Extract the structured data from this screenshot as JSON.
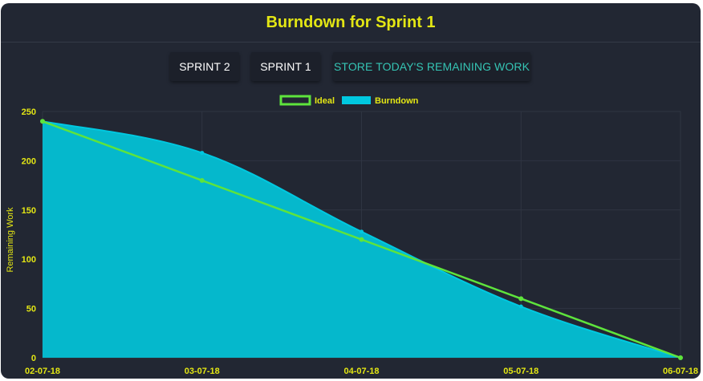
{
  "header": {
    "title": "Burndown for Sprint 1"
  },
  "toolbar": {
    "sprint2_label": "SPRINT 2",
    "sprint1_label": "SPRINT 1",
    "store_label": "STORE TODAY'S REMAINING WORK"
  },
  "colors": {
    "card_bg": "#222733",
    "title": "#e3e614",
    "ideal_line": "#5ee43c",
    "burndown_fill": "#05b8cc",
    "burndown_fill_light": "#00c8e0",
    "accent_button_text": "#35c4b4",
    "grid": "#2f3542"
  },
  "chart_data": {
    "type": "line",
    "title": "",
    "xlabel": "",
    "ylabel": "Remaining Work",
    "categories": [
      "02-07-18",
      "03-07-18",
      "04-07-18",
      "05-07-18",
      "06-07-18"
    ],
    "ylim": [
      0,
      250
    ],
    "yticks": [
      0,
      50,
      100,
      150,
      200,
      250
    ],
    "grid": true,
    "legend_position": "top-center",
    "series": [
      {
        "name": "Ideal",
        "style": "line",
        "values": [
          240,
          180,
          120,
          60,
          0
        ]
      },
      {
        "name": "Burndown",
        "style": "area",
        "values": [
          240,
          208,
          128,
          52,
          0
        ]
      }
    ]
  }
}
